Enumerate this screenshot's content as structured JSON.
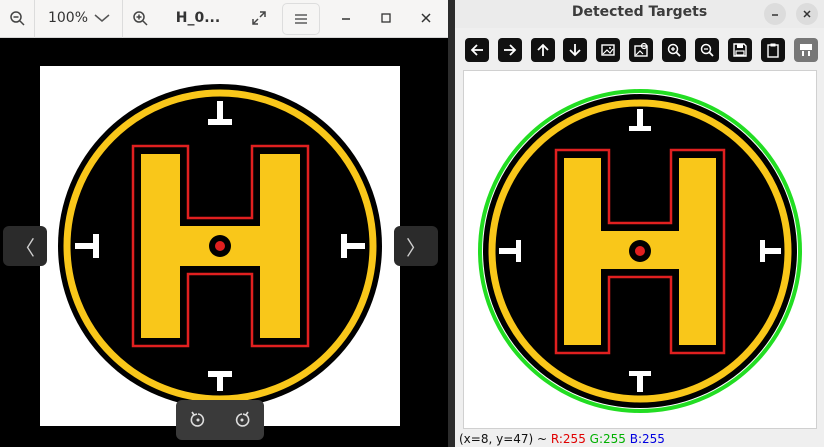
{
  "viewer": {
    "zoom_value": "100%",
    "file_title": "H_0...",
    "icons": {
      "zoom_out": "zoom-out-icon",
      "dropdown": "chevron-down-icon",
      "zoom_in": "zoom-in-icon",
      "fullscreen": "fullscreen-icon",
      "menu": "hamburger-menu-icon",
      "minimize": "minimize-icon",
      "maximize": "maximize-icon",
      "close": "close-icon"
    },
    "nav_prev": "〈",
    "nav_next": "〉"
  },
  "detect_window": {
    "title": "Detected Targets",
    "status": {
      "coords": "(x=8, y=47) ~",
      "r": "R:255",
      "g": "G:255",
      "b": "B:255"
    },
    "toolbar_icons": [
      "arrow-left-icon",
      "arrow-right-icon",
      "arrow-up-icon",
      "arrow-down-icon",
      "image-icon",
      "image-properties-icon",
      "zoom-in-icon",
      "zoom-out-icon",
      "save-icon",
      "clipboard-icon",
      "settings-panel-icon"
    ]
  },
  "colors": {
    "yellow": "#f9c71a",
    "black": "#000000",
    "red": "#e02020",
    "green_detection": "#22dd22",
    "status_r": "#e00000",
    "status_g": "#00b000",
    "status_b": "#0000e0"
  }
}
